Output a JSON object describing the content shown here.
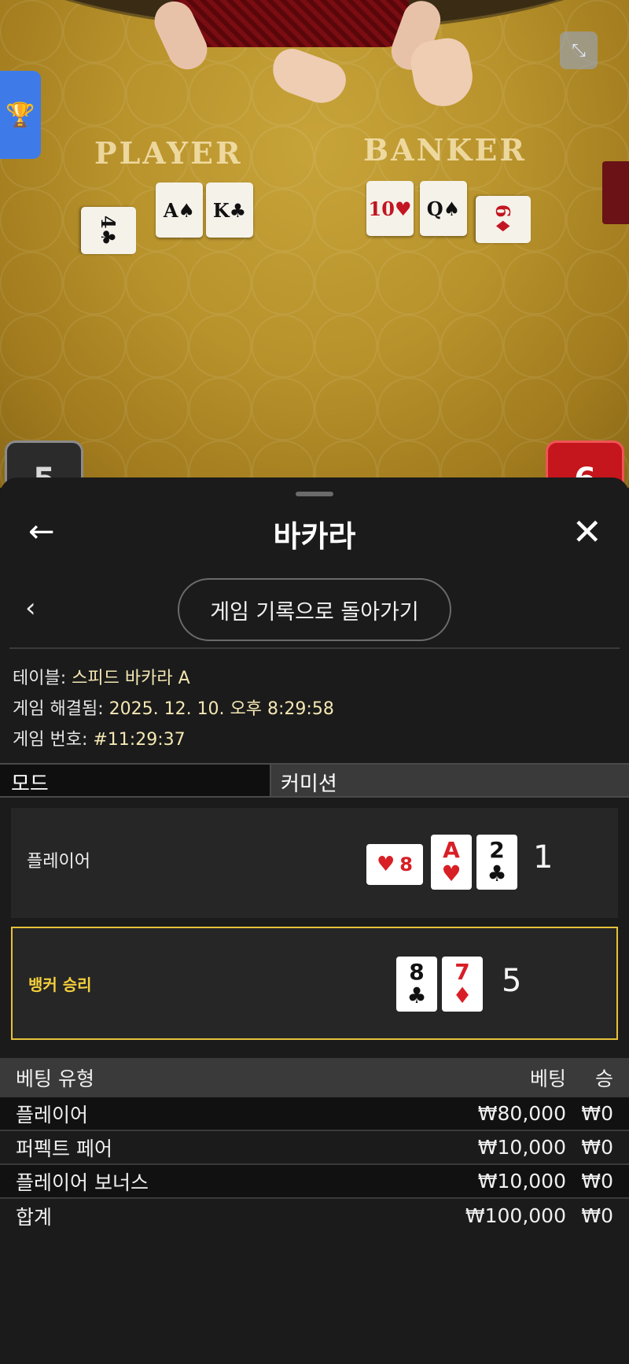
{
  "video": {
    "player_label": "PLAYER",
    "banker_label": "BANKER",
    "player_cards": [
      {
        "rank": "4",
        "suit": "♣",
        "color": "black"
      },
      {
        "rank": "A",
        "suit": "♠",
        "color": "black"
      },
      {
        "rank": "K",
        "suit": "♣",
        "color": "black"
      }
    ],
    "banker_cards": [
      {
        "rank": "10",
        "suit": "♥",
        "color": "red"
      },
      {
        "rank": "Q",
        "suit": "♠",
        "color": "black"
      },
      {
        "rank": "6",
        "suit": "♦",
        "color": "red"
      }
    ],
    "player_score_badge": "5",
    "banker_score_badge": "6"
  },
  "sheet": {
    "title": "바카라",
    "back_to_history": "게임 기록으로 돌아가기",
    "info": {
      "table_key": "테이블:",
      "table_val": "스피드 바카라 A",
      "resolved_key": "게임 해결됨:",
      "resolved_val": "2025. 12. 10. 오후 8:29:58",
      "game_no_key": "게임 번호:",
      "game_no_val": "#11:29:37"
    },
    "mode_label": "모드",
    "mode_value": "커미션",
    "player": {
      "name": "플레이어",
      "side_card": {
        "rank": "8",
        "suit": "♥",
        "color": "red"
      },
      "cards": [
        {
          "rank": "A",
          "suit": "♥",
          "color": "red"
        },
        {
          "rank": "2",
          "suit": "♣",
          "color": "black"
        }
      ],
      "score": "1"
    },
    "banker": {
      "name": "뱅커 승리",
      "cards": [
        {
          "rank": "8",
          "suit": "♣",
          "color": "black"
        },
        {
          "rank": "7",
          "suit": "♦",
          "color": "red"
        }
      ],
      "score": "5"
    },
    "bets": {
      "headers": [
        "베팅 유형",
        "베팅",
        "승"
      ],
      "rows": [
        [
          "플레이어",
          "₩80,000",
          "₩0"
        ],
        [
          "퍼펙트 페어",
          "₩10,000",
          "₩0"
        ],
        [
          "플레이어 보너스",
          "₩10,000",
          "₩0"
        ]
      ],
      "total": [
        "합계",
        "₩100,000",
        "₩0"
      ]
    }
  }
}
